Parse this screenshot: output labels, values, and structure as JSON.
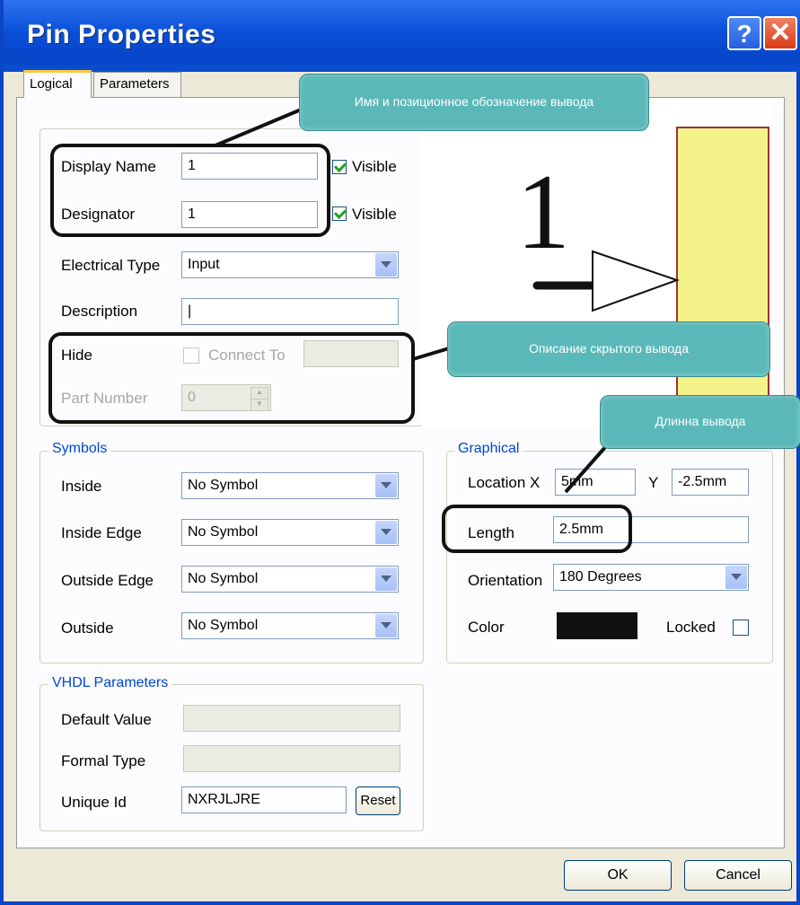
{
  "dialog": {
    "title": "Pin Properties",
    "help_label": "?",
    "close_label": "✕"
  },
  "tabs": [
    {
      "label": "Logical"
    },
    {
      "label": "Parameters"
    }
  ],
  "properties": {
    "display_name": {
      "label": "Display Name",
      "value": "1",
      "visible_label": "Visible",
      "visible_checked": true
    },
    "designator": {
      "label": "Designator",
      "value": "1",
      "visible_label": "Visible",
      "visible_checked": true
    },
    "electrical_type": {
      "label": "Electrical Type",
      "value": "Input"
    },
    "description": {
      "label": "Description",
      "value": "|"
    },
    "hide": {
      "label": "Hide",
      "checked": false,
      "connect_to_label": "Connect To",
      "connect_to_value": ""
    },
    "part_number": {
      "label": "Part Number",
      "value": "0"
    }
  },
  "preview": {
    "pin_number": "1",
    "body_color": "#f3f38a",
    "body_border": "#a0303a"
  },
  "symbols": {
    "legend": "Symbols",
    "inside": {
      "label": "Inside",
      "value": "No Symbol"
    },
    "inside_edge": {
      "label": "Inside Edge",
      "value": "No Symbol"
    },
    "outside_edge": {
      "label": "Outside Edge",
      "value": "No Symbol"
    },
    "outside": {
      "label": "Outside",
      "value": "No Symbol"
    }
  },
  "graphical": {
    "legend": "Graphical",
    "location_label": "Location X",
    "location_x": "5mm",
    "y_label": "Y",
    "location_y": "-2.5mm",
    "length_label": "Length",
    "length": "2.5mm",
    "orientation_label": "Orientation",
    "orientation": "180 Degrees",
    "color_label": "Color",
    "color_value": "#111111",
    "locked_label": "Locked",
    "locked": false
  },
  "vhdl": {
    "legend": "VHDL Parameters",
    "default_value_label": "Default Value",
    "default_value": "",
    "formal_type_label": "Formal Type",
    "formal_type": "",
    "unique_id_label": "Unique Id",
    "unique_id": "NXRJLJRE",
    "reset_label": "Reset"
  },
  "buttons": {
    "ok": "OK",
    "cancel": "Cancel"
  },
  "annotations": [
    {
      "text": "Имя и позиционное обозначение вывода"
    },
    {
      "text": "Описание скрытого вывода"
    },
    {
      "text": "Длинна вывода"
    }
  ]
}
